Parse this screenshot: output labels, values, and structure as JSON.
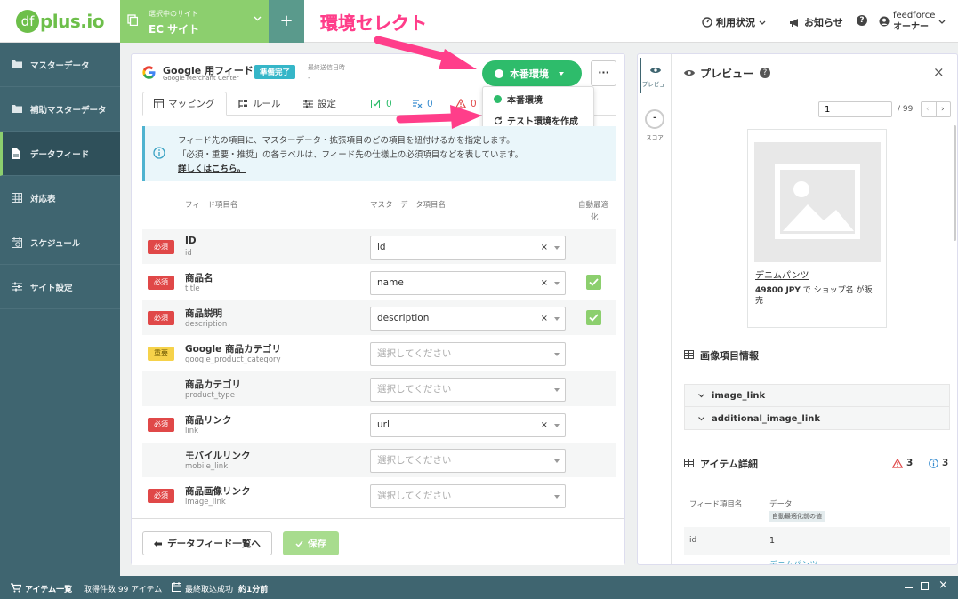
{
  "header": {
    "logo_text": "plus.io",
    "logo_badge": "df",
    "site_caption": "選択中のサイト",
    "site_name": "EC サイト",
    "add_symbol": "+",
    "annotation": "環境セレクト",
    "nav": {
      "usage": "利用状況",
      "notices": "お知らせ",
      "help": "?",
      "user_org": "feedforce",
      "user_role": "オーナー"
    }
  },
  "sidebar": {
    "items": [
      {
        "label": "マスターデータ",
        "icon": "folder-icon"
      },
      {
        "label": "補助マスターデータ",
        "icon": "folder-icon"
      },
      {
        "label": "データフィード",
        "icon": "document-icon"
      },
      {
        "label": "対応表",
        "icon": "table-icon"
      },
      {
        "label": "スケジュール",
        "icon": "schedule-icon"
      },
      {
        "label": "サイト設定",
        "icon": "sliders-icon"
      }
    ],
    "active_index": 2
  },
  "feed": {
    "title": "Google 用フィード",
    "subtitle": "Google Merchant Center",
    "status_badge": "準備完了",
    "last_sent_label": "最終送信日時",
    "last_sent_value": "-",
    "env_button": "本番環境",
    "more_button": "···",
    "env_menu": {
      "item_prod": "本番環境",
      "item_create_test": "テスト環境を作成"
    },
    "tabs": {
      "mapping": "マッピング",
      "rules": "ルール",
      "settings": "設定",
      "count_check": "0",
      "count_rule": "0",
      "count_warn": "0"
    },
    "info": {
      "line1": "フィード先の項目に、マスターデータ・拡張項目のどの項目を紐付けるかを指定します。",
      "line2": "「必須・重要・推奨」の各ラベルは、フィード先の仕様上の必須項目などを表しています。",
      "link": "詳しくはこちら。"
    },
    "columns": {
      "feed_item": "フィード項目名",
      "master_item": "マスターデータ項目名",
      "auto_opt_1": "自動最適",
      "auto_opt_2": "化"
    },
    "rows": [
      {
        "badge": "必須",
        "name": "ID",
        "key": "id",
        "value": "id",
        "clear": "×",
        "auto": false
      },
      {
        "badge": "必須",
        "name": "商品名",
        "key": "title",
        "value": "name",
        "clear": "×",
        "auto": true
      },
      {
        "badge": "必須",
        "name": "商品説明",
        "key": "description",
        "value": "description",
        "clear": "×",
        "auto": true
      },
      {
        "badge": "重要",
        "name": "Google 商品カテゴリ",
        "key": "google_product_category",
        "value": "",
        "placeholder": "選択してください",
        "auto": false
      },
      {
        "badge": "",
        "name": "商品カテゴリ",
        "key": "product_type",
        "value": "",
        "placeholder": "選択してください",
        "auto": false
      },
      {
        "badge": "必須",
        "name": "商品リンク",
        "key": "link",
        "value": "url",
        "clear": "×",
        "auto": false
      },
      {
        "badge": "",
        "name": "モバイルリンク",
        "key": "mobile_link",
        "value": "",
        "placeholder": "選択してください",
        "auto": false
      },
      {
        "badge": "必須",
        "name": "商品画像リンク",
        "key": "image_link",
        "value": "",
        "placeholder": "選択してください",
        "auto": false
      }
    ],
    "back_button": "データフィード一覧へ",
    "save_button": "保存"
  },
  "preview": {
    "rail_preview": "プレビュー",
    "rail_score": "スコア",
    "rail_score_value": "-",
    "title": "プレビュー",
    "help": "?",
    "close": "×",
    "page_value": "1",
    "page_total": "/ 99",
    "product_name": "デニムパンツ",
    "price": "49800 JPY",
    "price_suffix": " で ショップ名 が販",
    "price_line2": "売",
    "image_section": "画像項目情報",
    "image_fields": [
      "image_link",
      "additional_image_link"
    ],
    "details_section": "アイテム詳細",
    "warn_count": "3",
    "info_count": "3",
    "col_field": "フィード項目名",
    "col_data": "データ",
    "data_tag": "自動最適化前の値",
    "detail_rows": [
      {
        "field": "id",
        "value": "1"
      }
    ],
    "cut_text": "デニムパンツ"
  },
  "bottombar": {
    "items_label": "アイテム一覧",
    "count_text": "取得件数 99 アイテム",
    "last_import_label": "最終取込成功",
    "last_import_value": "約1分前"
  },
  "colors": {
    "brand_green": "#8ccf6e",
    "sidebar": "#3f6570",
    "env_green": "#2ebc6b",
    "required_red": "#e04848",
    "important_yellow": "#f6d24a",
    "annotation_pink": "#ff3e8a",
    "teal_badge": "#35b6c8"
  }
}
